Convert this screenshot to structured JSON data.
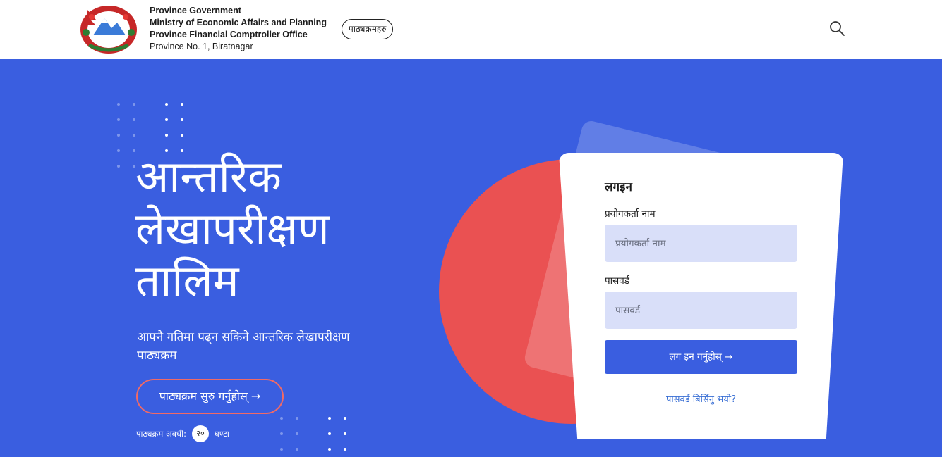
{
  "header": {
    "org_line1": "Province Government",
    "org_line2": "Ministry of Economic Affairs and Planning",
    "org_line3": "Province Financial Comptroller Office",
    "org_line4": "Province No. 1, Biratnagar",
    "courses_label": "पाठ्यक्रमहरु",
    "search_icon": "search-icon"
  },
  "hero": {
    "title_line1": "आन्तरिक",
    "title_line2": "लेखापरीक्षण",
    "title_line3": "तालिम",
    "subtitle": "आफ्नै गतिमा पढ्न सकिने आन्तरिक लेखापरीक्षण पाठ्यक्रम",
    "start_button": "पाठ्यक्रम सुरु गर्नुहोस् →",
    "duration_label": "पाठ्यक्रम अवधी:",
    "duration_value": "२०",
    "duration_unit": "घण्टा"
  },
  "login": {
    "title": "लगइन",
    "username_label": "प्रयोगकर्ता नाम",
    "username_placeholder": "प्रयोगकर्ता नाम",
    "password_label": "पासवर्ड",
    "password_placeholder": "पासवर्ड",
    "submit_label": "लग इन गर्नुहोस् →",
    "forgot_label": "पासवर्ड बिर्सिनु भयो?"
  },
  "colors": {
    "background": "#3a5ee0",
    "accent_red": "#ea5152",
    "field_bg": "#d9dff9",
    "link": "#3a6fd4"
  }
}
